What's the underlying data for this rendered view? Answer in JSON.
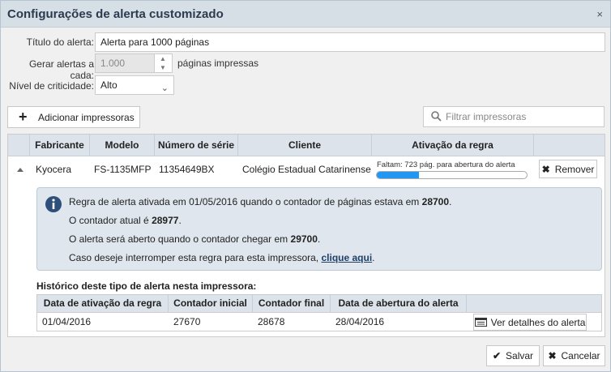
{
  "dialog": {
    "title": "Configurações de alerta customizado",
    "close_glyph": "×"
  },
  "form": {
    "titulo_label": "Título do alerta:",
    "titulo_value": "Alerta para 1000 páginas",
    "gerar_label": "Gerar alertas a cada:",
    "gerar_value": "1.000",
    "gerar_suffix": "páginas impressas",
    "nivel_label": "Nível de criticidade:",
    "nivel_value": "Alto"
  },
  "toolbar": {
    "add_label": "Adicionar impressoras",
    "filter_placeholder": "Filtrar impressoras"
  },
  "grid": {
    "columns": [
      "Fabricante",
      "Modelo",
      "Número de série",
      "Cliente",
      "Ativação da regra"
    ],
    "row": {
      "fabricante": "Kyocera",
      "modelo": "FS-1135MFP",
      "serie": "11354649BX",
      "cliente": "Colégio Estadual Catarinense",
      "progress_text": "Faltam: 723 pág. para abertura do alerta",
      "progress_fraction": 0.28,
      "remove_label": "Remover"
    }
  },
  "info": {
    "line1_prefix": "Regra de alerta ativada em 01/05/2016 quando o contador de páginas estava em ",
    "line1_value": "28700",
    "line1_suffix": ".",
    "line2_prefix": "O contador atual é ",
    "line2_value": "28977",
    "line2_suffix": ".",
    "line3_prefix": "O alerta será aberto quando o contador chegar em ",
    "line3_value": "29700",
    "line3_suffix": ".",
    "line4_prefix": "Caso deseje interromper esta regra para esta impressora, ",
    "line4_link": "clique aqui",
    "line4_suffix": "."
  },
  "history": {
    "title": "Histórico deste tipo de alerta nesta impressora:",
    "columns": [
      "Data de ativação da regra",
      "Contador inicial",
      "Contador final",
      "Data de abertura do alerta"
    ],
    "row": [
      "01/04/2016",
      "27670",
      "28678",
      "28/04/2016"
    ],
    "details_label": "Ver detalhes do alerta"
  },
  "footer": {
    "save_label": "Salvar",
    "cancel_label": "Cancelar"
  },
  "colors": {
    "accent": "#2196f3",
    "header_bg": "#dce3ea",
    "title_bg": "#d6dee6"
  }
}
